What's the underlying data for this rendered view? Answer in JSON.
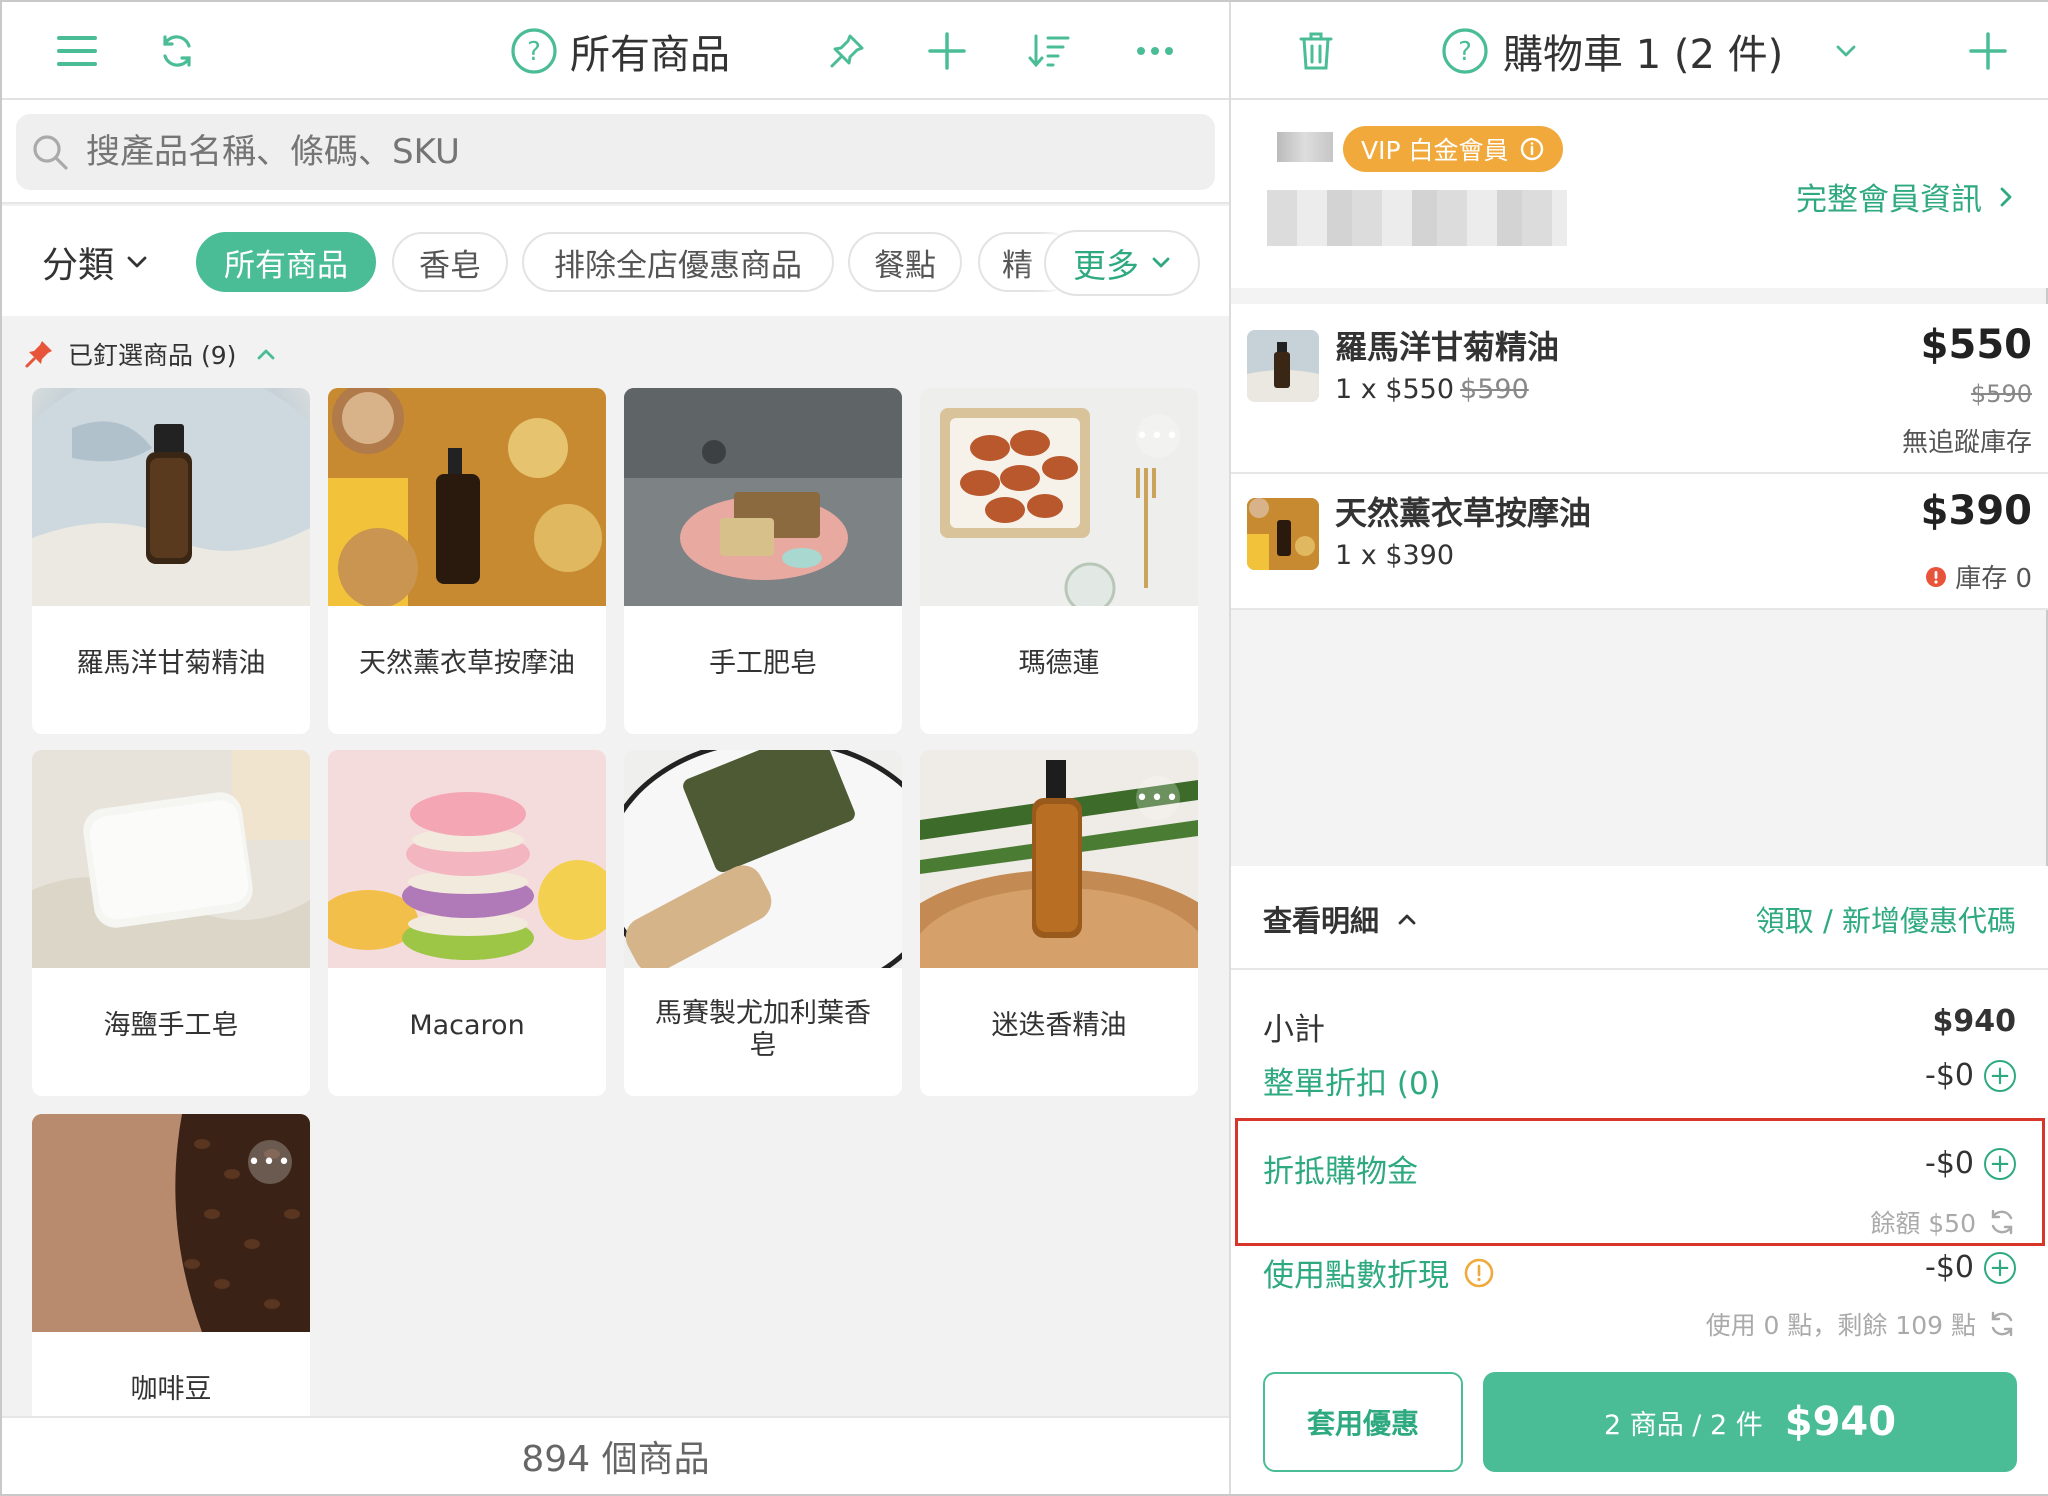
{
  "left": {
    "title": "所有商品",
    "search_placeholder": "搜產品名稱、條碼、SKU",
    "category_label": "分類",
    "chips": [
      "所有商品",
      "香皂",
      "排除全店優惠商品",
      "餐點",
      "精"
    ],
    "more_label": "更多",
    "pinned_label": "已釘選商品 (9)",
    "products": [
      {
        "name": "羅馬洋甘菊精油"
      },
      {
        "name": "天然薰衣草按摩油"
      },
      {
        "name": "手工肥皂"
      },
      {
        "name": "瑪德蓮"
      },
      {
        "name": "海鹽手工皂"
      },
      {
        "name": "Macaron"
      },
      {
        "name": "馬賽製尤加利葉香皂"
      },
      {
        "name": "迷迭香精油"
      },
      {
        "name": "咖啡豆"
      }
    ],
    "footer_count": "894 個商品"
  },
  "right": {
    "cart_title": "購物車 1 (2 件)",
    "vip_badge": "VIP 白金會員",
    "member_link": "完整會員資訊",
    "items": [
      {
        "name": "羅馬洋甘菊精油",
        "qty_price": "1 x $550",
        "orig_unit": "$590",
        "total": "$550",
        "orig_total": "$590",
        "note": "無追蹤庫存"
      },
      {
        "name": "天然薰衣草按摩油",
        "qty_price": "1 x $390",
        "total": "$390",
        "note": "庫存 0"
      }
    ],
    "detail_toggle": "查看明細",
    "coupon_link": "領取 / 新增優惠代碼",
    "subtotal_label": "小計",
    "subtotal_value": "$940",
    "order_discount_label": "整單折扣 (0)",
    "order_discount_value": "-$0",
    "credit_label": "折抵購物金",
    "credit_value": "-$0",
    "credit_balance": "餘額 $50",
    "points_label": "使用點數折現",
    "points_value": "-$0",
    "points_info": "使用 0 點，剩餘 109 點",
    "apply_button": "套用優惠",
    "checkout_count": "2 商品 / 2 件",
    "checkout_total": "$940"
  },
  "colors": {
    "accent": "#4bbd96",
    "vip": "#f0a93a",
    "highlight": "#d9362b",
    "warning": "#e8543a"
  }
}
